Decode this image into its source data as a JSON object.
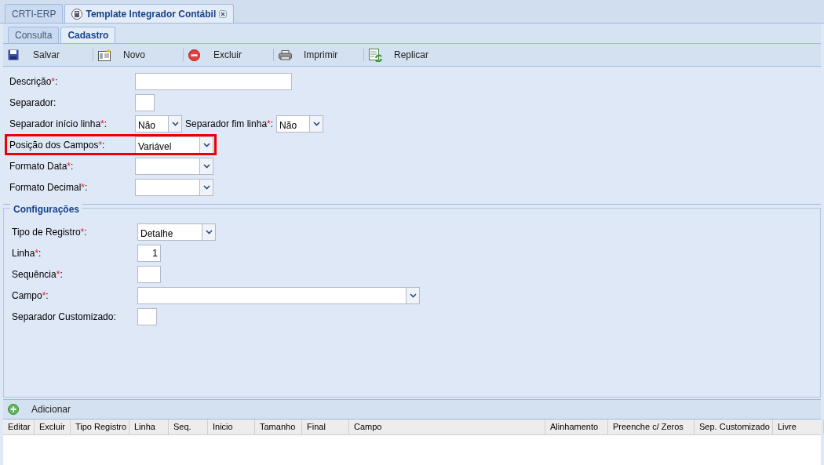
{
  "app_tabs": [
    {
      "label": "CRTI-ERP",
      "selected": false,
      "closable": false
    },
    {
      "label": "Template Integrador Contábil",
      "selected": true,
      "closable": true
    }
  ],
  "sub_tabs": [
    {
      "label": "Consulta",
      "selected": false
    },
    {
      "label": "Cadastro",
      "selected": true
    }
  ],
  "toolbar": [
    {
      "kind": "save",
      "label": "Salvar"
    },
    {
      "kind": "new",
      "label": "Novo"
    },
    {
      "kind": "delete",
      "label": "Excluir"
    },
    {
      "kind": "print",
      "label": "Imprimir"
    },
    {
      "kind": "replicate",
      "label": "Replicar"
    }
  ],
  "form": [
    {
      "highlighted": false,
      "items": [
        {
          "label": "Descrição",
          "asterisk": "*",
          "colon": ":",
          "kind": "text"
        }
      ]
    },
    {
      "highlighted": false,
      "items": [
        {
          "label": "Separador",
          "colon": ":",
          "kind": "text"
        }
      ]
    },
    {
      "highlighted": false,
      "items": [
        {
          "label": "Separador início linha",
          "asterisk": "*",
          "colon": ":",
          "kind": "combo",
          "value": "Não"
        },
        {
          "label": "Separador fim linha",
          "asterisk": "*",
          "colon": ":",
          "kind": "combo",
          "value": "Não"
        }
      ]
    },
    {
      "highlighted": true,
      "items": [
        {
          "label": "Posição dos Campos",
          "asterisk": "*",
          "colon": ":",
          "kind": "combo",
          "value": "Variável"
        }
      ]
    },
    {
      "highlighted": false,
      "items": [
        {
          "label": "Formato Data",
          "asterisk": "*",
          "colon": ":",
          "kind": "combo"
        }
      ]
    },
    {
      "highlighted": false,
      "items": [
        {
          "label": "Formato Decimal",
          "asterisk": "*",
          "colon": ":",
          "kind": "combo"
        }
      ]
    }
  ],
  "configuracoes": {
    "title": "Configurações",
    "fields": [
      {
        "label": "Tipo de Registro",
        "asterisk": "*",
        "colon": ":",
        "kind": "combo",
        "value": "Detalhe"
      },
      {
        "label": "Linha",
        "asterisk": "*",
        "colon": ":",
        "kind": "number",
        "value": "1"
      },
      {
        "label": "Sequência",
        "asterisk": "*",
        "colon": ":",
        "kind": "text"
      },
      {
        "label": "Campo",
        "asterisk": "*",
        "colon": ":",
        "kind": "combo"
      },
      {
        "label": "Separador Customizado",
        "colon": ":",
        "kind": "text"
      }
    ]
  },
  "grid": {
    "add_button": "Adicionar",
    "columns": [
      "Editar",
      "Excluir",
      "Tipo Registro",
      "Linha",
      "Seq.",
      "Inicio",
      "Tamanho",
      "Final",
      "Campo",
      "Alinhamento",
      "Preenche c/ Zeros",
      "Sep. Customizado",
      "Livre"
    ]
  }
}
